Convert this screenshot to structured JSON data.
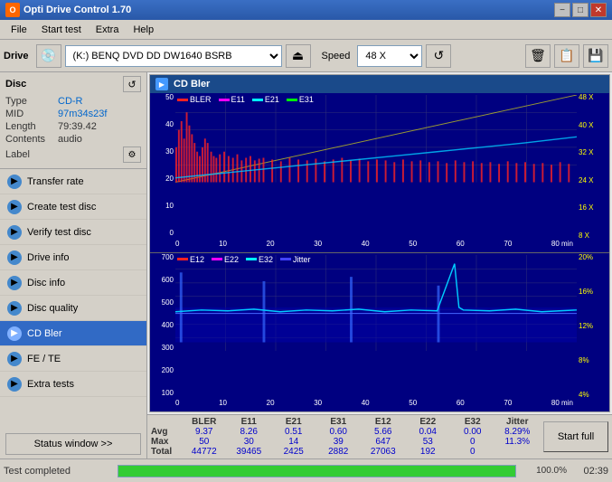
{
  "titleBar": {
    "title": "Opti Drive Control 1.70",
    "minimizeBtn": "−",
    "maximizeBtn": "□",
    "closeBtn": "✕"
  },
  "menuBar": {
    "items": [
      "File",
      "Start test",
      "Extra",
      "Help"
    ]
  },
  "toolbar": {
    "driveLabel": "Drive",
    "driveValue": "(K:)  BENQ DVD DD DW1640 BSRB",
    "speedLabel": "Speed",
    "speedValue": "48 X"
  },
  "disc": {
    "title": "Disc",
    "typeLabel": "Type",
    "typeValue": "CD-R",
    "midLabel": "MID",
    "midValue": "97m34s23f",
    "lengthLabel": "Length",
    "lengthValue": "79:39.42",
    "contentsLabel": "Contents",
    "contentsValue": "audio",
    "labelLabel": "Label",
    "labelValue": ""
  },
  "navItems": [
    {
      "id": "transfer-rate",
      "label": "Transfer rate",
      "active": false
    },
    {
      "id": "create-test-disc",
      "label": "Create test disc",
      "active": false
    },
    {
      "id": "verify-test-disc",
      "label": "Verify test disc",
      "active": false
    },
    {
      "id": "drive-info",
      "label": "Drive info",
      "active": false
    },
    {
      "id": "disc-info",
      "label": "Disc info",
      "active": false
    },
    {
      "id": "disc-quality",
      "label": "Disc quality",
      "active": false
    },
    {
      "id": "cd-bler",
      "label": "CD Bler",
      "active": true
    },
    {
      "id": "fe-te",
      "label": "FE / TE",
      "active": false
    },
    {
      "id": "extra-tests",
      "label": "Extra tests",
      "active": false
    }
  ],
  "statusBtn": "Status window >>",
  "chartTitle": "CD Bler",
  "topChart": {
    "legend": [
      "BLER",
      "E11",
      "E21",
      "E31"
    ],
    "legendColors": [
      "#ff0000",
      "#ff00ff",
      "#00ffff",
      "#00ff00"
    ],
    "yLabels": [
      "50",
      "40",
      "30",
      "20",
      "10"
    ],
    "xLabels": [
      "0",
      "10",
      "20",
      "30",
      "40",
      "50",
      "60",
      "70",
      "80"
    ],
    "yRightLabels": [
      "48 X",
      "40 X",
      "32 X",
      "24 X",
      "16 X",
      "8 X"
    ],
    "xAxisLabel": "min"
  },
  "bottomChart": {
    "legend": [
      "E12",
      "E22",
      "E32",
      "Jitter"
    ],
    "legendColors": [
      "#ff0000",
      "#ff00ff",
      "#00ffff",
      "#0000ff"
    ],
    "yLabels": [
      "700",
      "600",
      "500",
      "400",
      "300",
      "200",
      "100"
    ],
    "xLabels": [
      "0",
      "10",
      "20",
      "30",
      "40",
      "50",
      "60",
      "70",
      "80"
    ],
    "yRightLabels": [
      "20%",
      "16%",
      "12%",
      "8%",
      "4%"
    ],
    "xAxisLabel": "min"
  },
  "statsHeaders": [
    "BLER",
    "E11",
    "E21",
    "E31",
    "E12",
    "E22",
    "E32",
    "Jitter"
  ],
  "statsRows": [
    {
      "label": "Avg",
      "values": [
        "9.37",
        "8.26",
        "0.51",
        "0.60",
        "5.66",
        "0.04",
        "0.00",
        "8.29%"
      ]
    },
    {
      "label": "Max",
      "values": [
        "50",
        "30",
        "14",
        "39",
        "647",
        "53",
        "0",
        "11.3%"
      ]
    },
    {
      "label": "Total",
      "values": [
        "44772",
        "39465",
        "2425",
        "2882",
        "27063",
        "192",
        "0",
        ""
      ]
    }
  ],
  "startFullBtn": "Start full",
  "statusBar": {
    "text": "Test completed",
    "progress": 100,
    "progressLabel": "100.0%",
    "time": "02:39"
  }
}
